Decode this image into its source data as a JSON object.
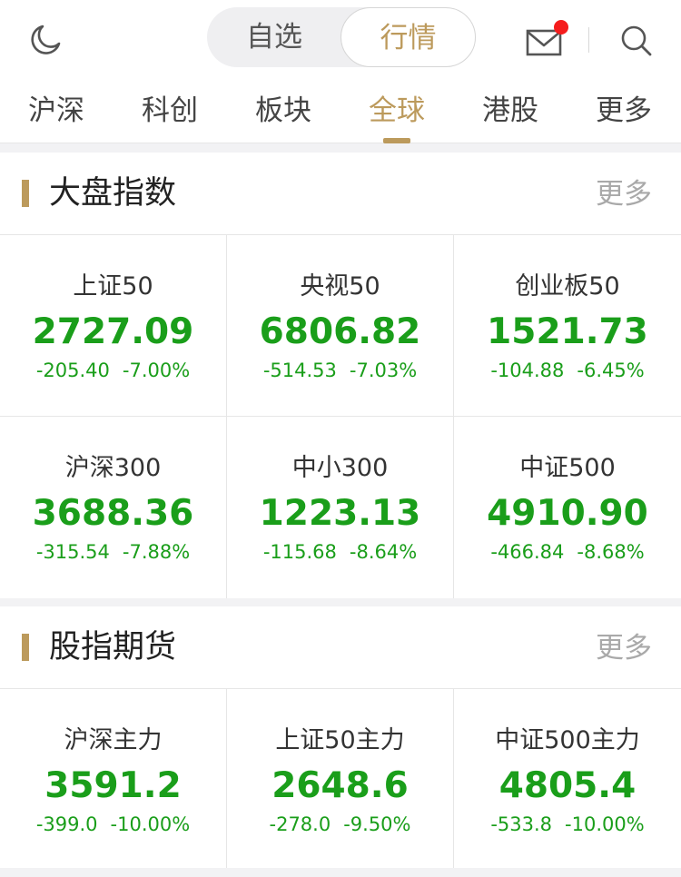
{
  "header": {
    "segments": [
      {
        "label": "自选",
        "active": false
      },
      {
        "label": "行情",
        "active": true
      }
    ],
    "icons": [
      "moon-icon",
      "mail-icon",
      "search-icon"
    ],
    "mail_has_unread": true
  },
  "tabs": [
    {
      "label": "沪深",
      "active": false
    },
    {
      "label": "科创",
      "active": false
    },
    {
      "label": "板块",
      "active": false
    },
    {
      "label": "全球",
      "active": true
    },
    {
      "label": "港股",
      "active": false
    },
    {
      "label": "更多",
      "active": false
    }
  ],
  "sections": [
    {
      "title": "大盘指数",
      "more": "更多",
      "items": [
        {
          "name": "上证50",
          "price": "2727.09",
          "change": "-205.40",
          "pct": "-7.00%"
        },
        {
          "name": "央视50",
          "price": "6806.82",
          "change": "-514.53",
          "pct": "-7.03%"
        },
        {
          "name": "创业板50",
          "price": "1521.73",
          "change": "-104.88",
          "pct": "-6.45%"
        },
        {
          "name": "沪深300",
          "price": "3688.36",
          "change": "-315.54",
          "pct": "-7.88%"
        },
        {
          "name": "中小300",
          "price": "1223.13",
          "change": "-115.68",
          "pct": "-8.64%"
        },
        {
          "name": "中证500",
          "price": "4910.90",
          "change": "-466.84",
          "pct": "-8.68%"
        }
      ]
    },
    {
      "title": "股指期货",
      "more": "更多",
      "items": [
        {
          "name": "沪深主力",
          "price": "3591.2",
          "change": "-399.0",
          "pct": "-10.00%"
        },
        {
          "name": "上证50主力",
          "price": "2648.6",
          "change": "-278.0",
          "pct": "-9.50%"
        },
        {
          "name": "中证500主力",
          "price": "4805.4",
          "change": "-533.8",
          "pct": "-10.00%"
        }
      ]
    }
  ],
  "colors": {
    "accent": "#bc9a5c",
    "down": "#1a9e1a",
    "badge": "#f51c1c",
    "muted": "#a9a9a9"
  }
}
